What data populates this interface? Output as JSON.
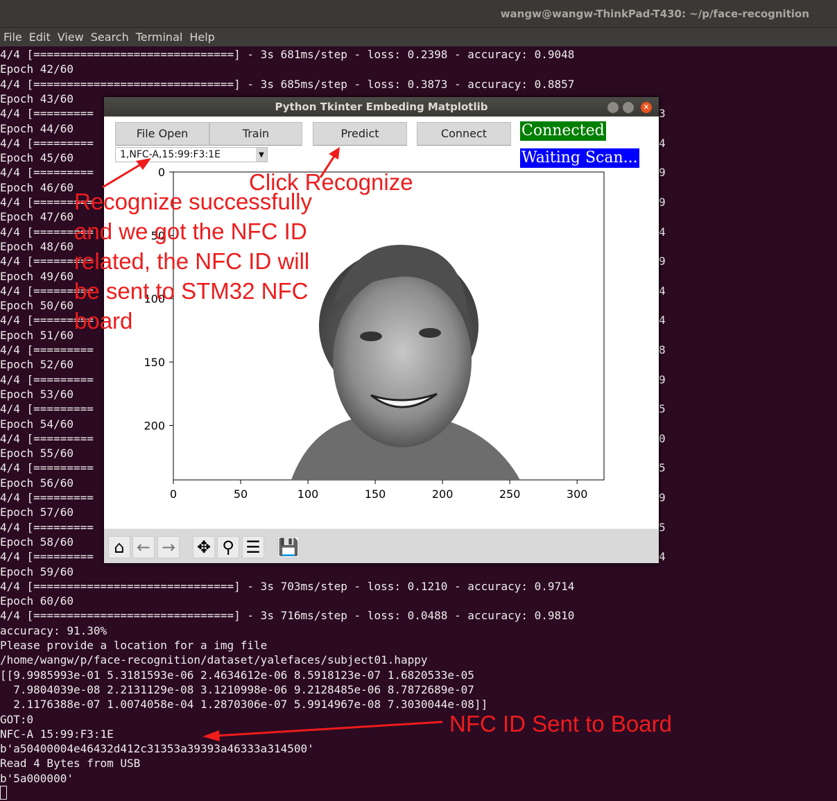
{
  "terminal": {
    "title": "wangw@wangw-ThinkPad-T430: ~/p/face-recognition",
    "menu": [
      "File",
      "Edit",
      "View",
      "Search",
      "Terminal",
      "Help"
    ],
    "lines": [
      "4/4 [==============================] - 3s 681ms/step - loss: 0.2398 - accuracy: 0.9048",
      "Epoch 42/60",
      "4/4 [==============================] - 3s 685ms/step - loss: 0.3873 - accuracy: 0.8857",
      "Epoch 43/60",
      "4/4 [=========",
      "Epoch 44/60",
      "4/4 [=========",
      "Epoch 45/60",
      "4/4 [=========",
      "Epoch 46/60",
      "4/4 [=========",
      "Epoch 47/60",
      "4/4 [=========",
      "Epoch 48/60",
      "4/4 [=========",
      "Epoch 49/60",
      "4/4 [=========",
      "Epoch 50/60",
      "4/4 [=========",
      "Epoch 51/60",
      "4/4 [=========",
      "Epoch 52/60",
      "4/4 [=========",
      "Epoch 53/60",
      "4/4 [=========",
      "Epoch 54/60",
      "4/4 [=========",
      "Epoch 55/60",
      "4/4 [=========",
      "Epoch 56/60",
      "4/4 [=========",
      "Epoch 57/60",
      "4/4 [=========",
      "Epoch 58/60",
      "4/4 [=========",
      "Epoch 59/60",
      "4/4 [==============================] - 3s 703ms/step - loss: 0.1210 - accuracy: 0.9714",
      "Epoch 60/60",
      "4/4 [==============================] - 3s 716ms/step - loss: 0.0488 - accuracy: 0.9810",
      "accuracy: 91.30%",
      "Please provide a location for a img file",
      "/home/wangw/p/face-recognition/dataset/yalefaces/subject01.happy",
      "[[9.9985993e-01 5.3181593e-06 2.4634612e-06 8.5918123e-07 1.6820533e-05",
      "  7.9804039e-08 2.2131129e-08 3.1210998e-06 9.2128485e-06 8.7872689e-07",
      "  2.1176388e-07 1.0074058e-04 1.2870306e-07 5.9914967e-08 7.3030044e-08]]",
      "GOT:0",
      "NFC-A 15:99:F3:1E",
      "b'a50400004e46432d412c31353a39393a46333a314500'",
      "Read 4 Bytes from USB",
      "b'5a000000'"
    ],
    "right_fragments": [
      "3",
      "4",
      "9",
      "9",
      "4",
      "9",
      "4",
      "4",
      "8",
      "9",
      "5",
      "0",
      "5",
      "9",
      "5",
      "4"
    ]
  },
  "window": {
    "title": "Python Tkinter Embeding Matplotlib",
    "buttons": {
      "file_open": "File Open",
      "train": "Train",
      "predict": "Predict",
      "connect": "Connect"
    },
    "combo_value": "1,NFC-A,15:99:F3:1E",
    "status_connected": "Connected",
    "status_scan": "Waiting Scan...",
    "colors": {
      "connected_bg": "#008000",
      "connected_fg": "#ffffff",
      "scan_bg": "#0000ff",
      "scan_fg": "#ffffff"
    },
    "toolbar_icons": [
      "home-icon",
      "back-arrow-icon",
      "forward-arrow-icon",
      "pan-icon",
      "zoom-icon",
      "configure-subplots-icon",
      "save-icon"
    ],
    "plot": {
      "x_ticks": [
        "0",
        "50",
        "100",
        "150",
        "200",
        "250",
        "300"
      ],
      "y_ticks": [
        "0",
        "50",
        "100",
        "150",
        "200"
      ],
      "xlim": [
        0,
        320
      ],
      "ylim": [
        243,
        0
      ]
    }
  },
  "annotations": {
    "click": "Click Recognize",
    "recognize": [
      "Recognize successfully",
      "and we got the NFC ID",
      "related, the NFC ID will",
      "be sent to STM32 NFC",
      "board"
    ],
    "sent": "NFC ID Sent to Board",
    "color": "#ee1c1c"
  }
}
